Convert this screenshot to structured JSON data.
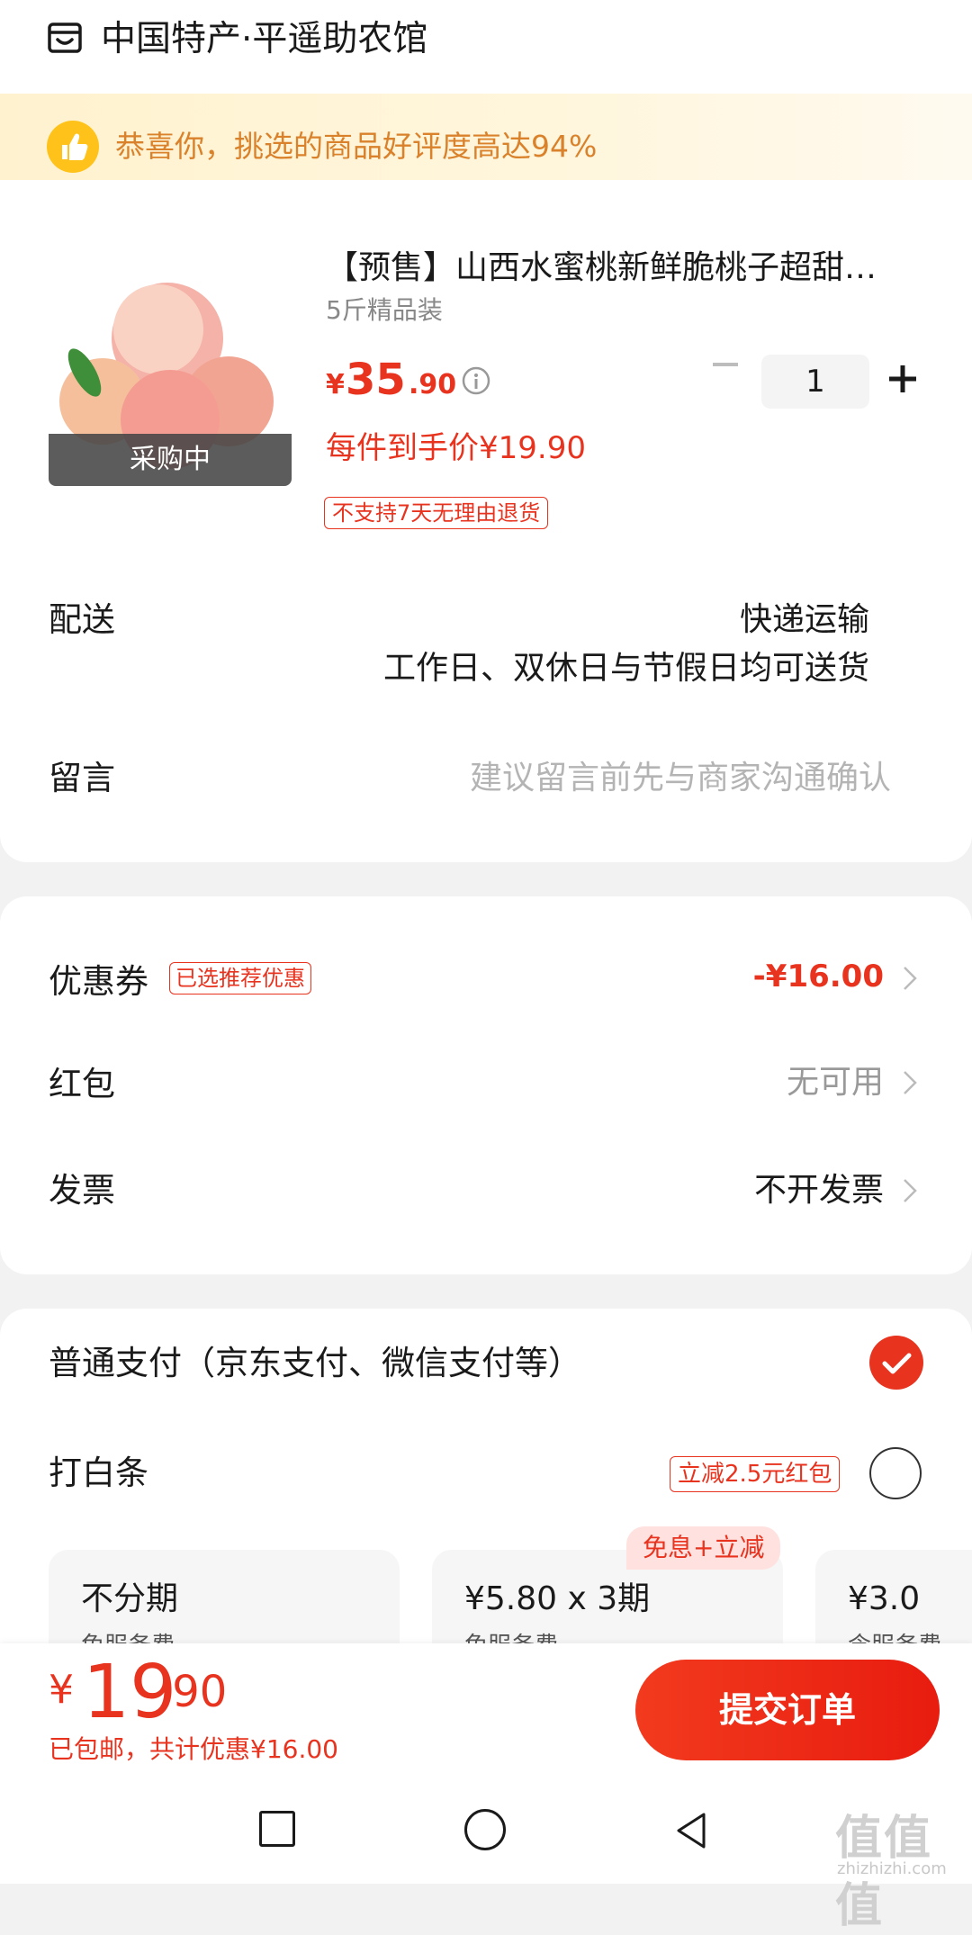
{
  "header": {
    "store_name": "中国特产·平遥助农馆"
  },
  "banner": {
    "text": "恭喜你，挑选的商品好评度高达94%"
  },
  "product": {
    "title": "【预售】山西水蜜桃新鲜脆桃子超甜…",
    "spec": "5斤精品装",
    "image_badge": "采购中",
    "price_currency": "¥",
    "price_int": "35",
    "price_dec": ".90",
    "per_price": "每件到手价¥19.90",
    "return_tag": "不支持7天无理由退货",
    "quantity": "1"
  },
  "delivery": {
    "label": "配送",
    "method": "快递运输",
    "schedule": "工作日、双休日与节假日均可送货"
  },
  "message": {
    "label": "留言",
    "placeholder": "建议留言前先与商家沟通确认"
  },
  "discounts": {
    "coupon_label": "优惠券",
    "coupon_tag": "已选推荐优惠",
    "coupon_value": "-¥16.00",
    "redpacket_label": "红包",
    "redpacket_value": "无可用",
    "invoice_label": "发票",
    "invoice_value": "不开发票"
  },
  "payment": {
    "normal_label": "普通支付（京东支付、微信支付等）",
    "baitiao_label": "打白条",
    "baitiao_tag": "立减2.5元红包",
    "plan_flag": "免息+立减",
    "plans": [
      {
        "title": "不分期",
        "sub": "免服务费"
      },
      {
        "title": "¥5.80 x 3期",
        "sub": "免服务费"
      },
      {
        "title": "¥3.0",
        "sub": "含服务费"
      }
    ]
  },
  "footer": {
    "total_currency": "¥",
    "total_int": "19",
    "total_dec": ".90",
    "total_sub": "已包邮，共计优惠¥16.00",
    "submit_label": "提交订单"
  },
  "watermark": {
    "text": "值值值",
    "sub": "zhizhizhi.com"
  }
}
